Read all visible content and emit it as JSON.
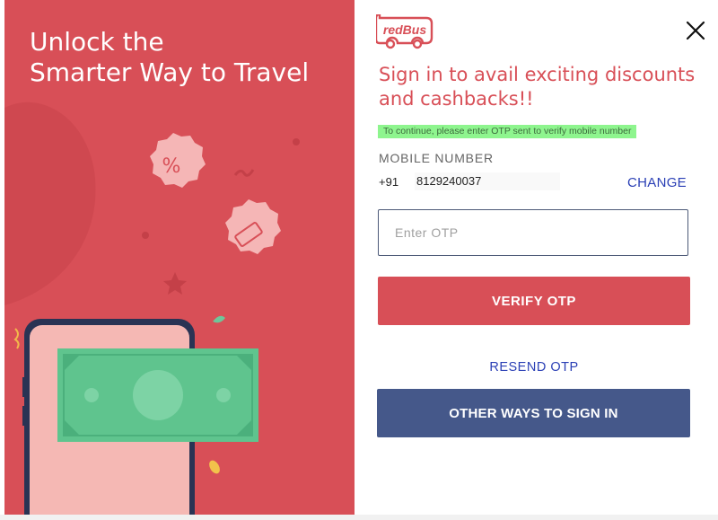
{
  "promo": {
    "title_line1": "Unlock the",
    "title_line2": "Smarter Way to Travel"
  },
  "logo": {
    "text": "redBus"
  },
  "heading": {
    "line1": "Sign in to avail exciting discounts",
    "line2": "and cashbacks!!"
  },
  "notice": "To continue, please enter OTP sent to verify mobile number",
  "mobile": {
    "label": "MOBILE NUMBER",
    "country_code": "+91",
    "number": "8129240037",
    "change_label": "CHANGE"
  },
  "otp": {
    "placeholder": "Enter OTP",
    "value": ""
  },
  "buttons": {
    "verify": "VERIFY OTP",
    "resend": "RESEND OTP",
    "other_ways": "OTHER WAYS TO SIGN IN"
  },
  "icons": {
    "close": "close-icon",
    "discount": "percent-badge-icon",
    "ticket": "ticket-badge-icon"
  },
  "colors": {
    "brand_red": "#d84f57",
    "link_blue": "#2a3fb5",
    "secondary_button": "#45588a",
    "notice_green": "#8ef58e"
  }
}
